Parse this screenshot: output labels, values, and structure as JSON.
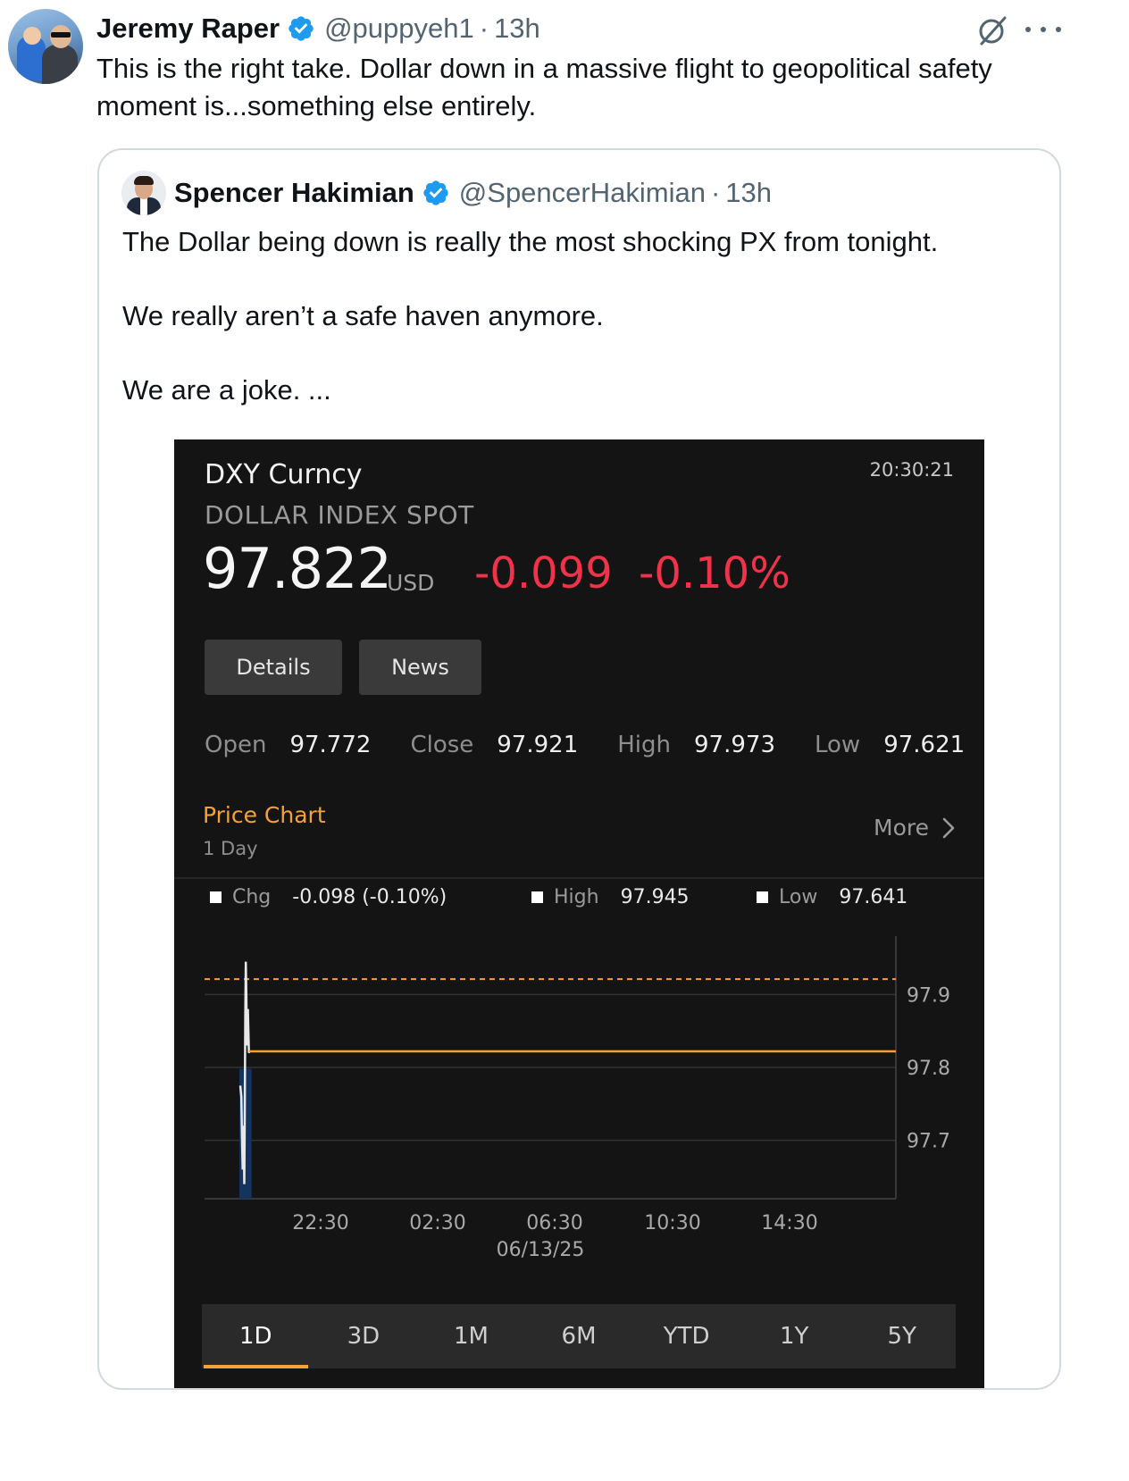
{
  "tweet": {
    "author_name": "Jeremy Raper",
    "handle": "@puppyeh1",
    "separator": "·",
    "time": "13h",
    "text": "This is the right take. Dollar down in a massive flight to geopolitical safety moment is...something else entirely."
  },
  "quote": {
    "author_name": "Spencer Hakimian",
    "handle": "@SpencerHakimian",
    "separator": "·",
    "time": "13h",
    "lines": [
      "The Dollar being down is really the most shocking PX from tonight.",
      "We really aren’t a safe haven anymore.",
      "We are a joke. ..."
    ]
  },
  "terminal": {
    "ticker": "DXY Curncy",
    "long_name": "DOLLAR INDEX SPOT",
    "clock": "20:30:21",
    "price": "97.822",
    "currency": "USD",
    "change": "-0.099",
    "change_pct": "-0.10%",
    "buttons": {
      "details": "Details",
      "news": "News"
    },
    "stats": [
      {
        "label": "Open",
        "value": "97.772"
      },
      {
        "label": "Close",
        "value": "97.921"
      },
      {
        "label": "High",
        "value": "97.973"
      },
      {
        "label": "Low",
        "value": "97.621"
      }
    ],
    "price_chart": {
      "title": "Price Chart",
      "period": "1 Day",
      "more_label": "More"
    },
    "legend": {
      "chg_label": "Chg",
      "chg_value": "-0.098 (-0.10%)",
      "high_label": "High",
      "high_value": "97.945",
      "low_label": "Low",
      "low_value": "97.641"
    },
    "ranges": [
      "1D",
      "3D",
      "1M",
      "6M",
      "YTD",
      "1Y",
      "5Y"
    ],
    "active_range": "1D"
  },
  "colors": {
    "negative": "#f0334a",
    "accent_orange": "#f5a13a",
    "verified_blue": "#1d9bf0",
    "price_line": "#e8e8e8",
    "volume_fill": "#14335f",
    "reference_line": "#f5a13a"
  },
  "chart_data": {
    "type": "line",
    "y_ticks": [
      "97.9",
      "97.8",
      "97.7"
    ],
    "x_ticks": [
      "22:30",
      "02:30",
      "06:30",
      "10:30",
      "14:30"
    ],
    "x_date_label": "06/13/25",
    "ylim": [
      97.62,
      97.98
    ],
    "reference_line": 97.921,
    "previous_close": 97.921,
    "x": [
      0.0,
      0.6,
      1.0,
      1.4,
      1.7,
      2.0,
      2.3,
      2.6,
      2.9,
      3.2,
      3.5,
      3.8,
      4.1,
      4.4,
      4.7,
      5.0,
      5.3,
      5.6,
      5.9,
      6.2,
      6.5,
      7.0,
      7.5,
      8.0,
      8.6
    ],
    "y": [
      97.775,
      97.76,
      97.705,
      97.66,
      97.72,
      97.7,
      97.64,
      97.73,
      97.87,
      97.945,
      97.9,
      97.83,
      97.86,
      97.88,
      97.85,
      97.82,
      97.822,
      97.822,
      97.822,
      97.822,
      97.822,
      97.822,
      97.822,
      97.822,
      97.822
    ],
    "x_units": "minutes after open (first trades, then flat line)",
    "last_value": 97.822
  }
}
